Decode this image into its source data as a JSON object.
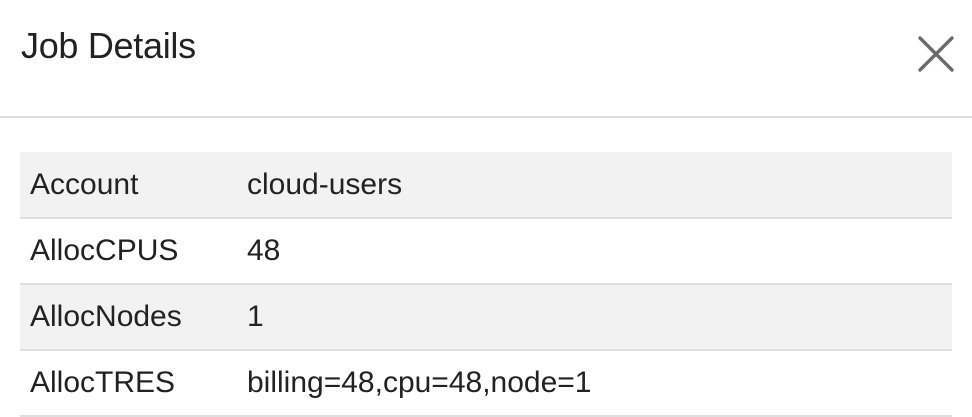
{
  "modal": {
    "title": "Job Details",
    "close_icon": "close-x-icon"
  },
  "details": {
    "rows": [
      {
        "key": "Account",
        "value": "cloud-users"
      },
      {
        "key": "AllocCPUS",
        "value": "48"
      },
      {
        "key": "AllocNodes",
        "value": "1"
      },
      {
        "key": "AllocTRES",
        "value": "billing=48,cpu=48,node=1"
      }
    ]
  },
  "colors": {
    "title_text": "#222222",
    "close_icon": "#6b6b6b",
    "row_stripe": "#f2f2f2",
    "divider": "#dedede"
  }
}
